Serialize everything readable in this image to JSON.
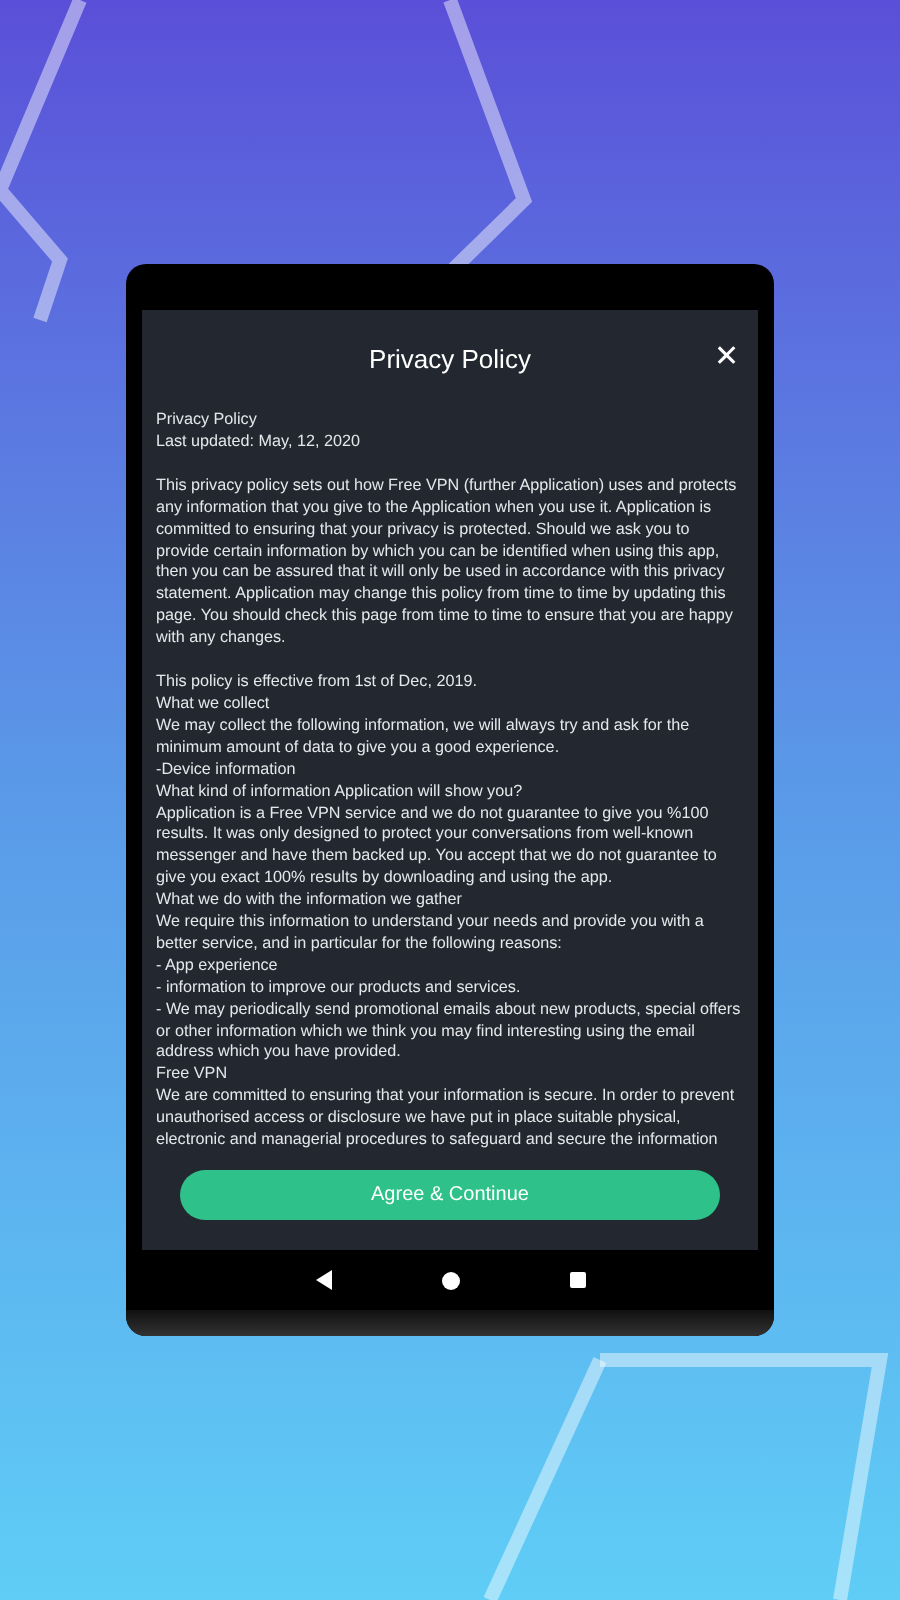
{
  "dialog": {
    "title": "Privacy Policy",
    "close_label": "✕",
    "sections": [
      {
        "kind": "lines",
        "lines": [
          "Privacy Policy",
          "Last updated: May, 12, 2020"
        ]
      },
      {
        "kind": "paragraph",
        "text": "This privacy policy sets out how Free VPN (further Application) uses and protects any information that you give to the Application when you use it. Application is committed to ensuring that your privacy is protected. Should we ask you to provide certain information by which you can be identified when using this app, then you can be assured that it will only be used in accordance with this privacy statement. Application may change this policy from time to time by updating this page. You should check this page from time to time to ensure that you are happy with any changes."
      },
      {
        "kind": "lines",
        "lines": [
          "This policy is effective from 1st of Dec, 2019.",
          "What we collect",
          "We may collect the following information, we will always try and ask for the minimum amount of data to give you a good experience.",
          "-Device information",
          "What kind of information Application will show you?",
          "Application is a Free VPN service and we do not guarantee to give you %100 results. It was only designed to protect your conversations from well-known messenger and have them backed up. You accept that we do not guarantee to give you exact 100% results by downloading and using the app.",
          "What we do with the information we gather",
          "We require this information to understand your needs and provide you with a better service, and in particular for the following reasons:",
          "- App experience",
          "- information to improve our products and services.",
          "- We may periodically send promotional emails about new products, special offers or other information which we think you may find interesting using the email address which you have provided.",
          "Free VPN",
          "We are committed to ensuring that your information is secure. In order to prevent unauthorised access or disclosure we have put in place suitable physical, electronic and managerial procedures to safeguard and secure the information"
        ]
      }
    ],
    "button": "Agree & Continue"
  }
}
